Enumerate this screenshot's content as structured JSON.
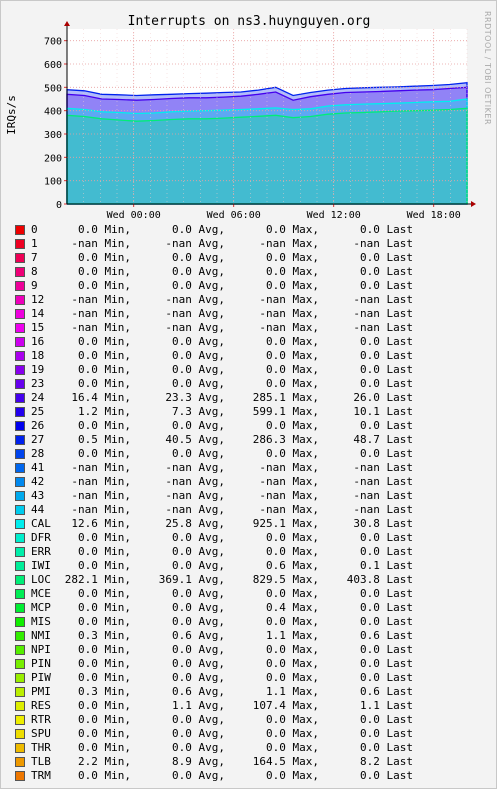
{
  "chart_data": {
    "type": "area",
    "title": "Interrupts on ns3.huynguyen.org",
    "ylabel": "IRQs/s",
    "watermark": "RRDTOOL / TOBI OETIKER",
    "ylim": [
      0,
      750
    ],
    "yticks": [
      0,
      100,
      200,
      300,
      400,
      500,
      600,
      700
    ],
    "xticks": [
      {
        "label": "Wed 00:00",
        "t": 4
      },
      {
        "label": "Wed 06:00",
        "t": 10
      },
      {
        "label": "Wed 12:00",
        "t": 16
      },
      {
        "label": "Wed 18:00",
        "t": 22
      }
    ],
    "xlim": [
      0,
      24
    ],
    "grid": true,
    "series_shown": [
      {
        "name": "LOC",
        "values": [
          380,
          375,
          365,
          360,
          355,
          358,
          362,
          365,
          365,
          368,
          372,
          376,
          380,
          370,
          375,
          385,
          390,
          392,
          395,
          398,
          400,
          402,
          405,
          410
        ]
      },
      {
        "name": "CAL",
        "values": [
          410,
          405,
          395,
          392,
          388,
          390,
          395,
          398,
          400,
          402,
          405,
          408,
          412,
          405,
          408,
          420,
          425,
          428,
          430,
          432,
          435,
          438,
          440,
          450
        ]
      },
      {
        "name": "24",
        "values": [
          470,
          465,
          450,
          448,
          445,
          448,
          452,
          455,
          455,
          458,
          462,
          470,
          480,
          445,
          460,
          470,
          478,
          480,
          482,
          485,
          488,
          490,
          495,
          500
        ]
      },
      {
        "name": "27",
        "values": [
          490,
          485,
          470,
          468,
          465,
          468,
          470,
          473,
          475,
          478,
          480,
          488,
          500,
          465,
          478,
          488,
          495,
          498,
          500,
          502,
          505,
          508,
          512,
          520
        ]
      }
    ],
    "legend": [
      {
        "name": "0",
        "color": "#ee0000",
        "min": "0.0",
        "avg": "0.0",
        "max": "0.0",
        "last": "0.0"
      },
      {
        "name": "1",
        "color": "#ee0022",
        "min": "-nan",
        "avg": "-nan",
        "max": "-nan",
        "last": "-nan"
      },
      {
        "name": "7",
        "color": "#ee0055",
        "min": "0.0",
        "avg": "0.0",
        "max": "0.0",
        "last": "0.0"
      },
      {
        "name": "8",
        "color": "#ee0077",
        "min": "0.0",
        "avg": "0.0",
        "max": "0.0",
        "last": "0.0"
      },
      {
        "name": "9",
        "color": "#ee0099",
        "min": "0.0",
        "avg": "0.0",
        "max": "0.0",
        "last": "0.0"
      },
      {
        "name": "12",
        "color": "#ee00bb",
        "min": "-nan",
        "avg": "-nan",
        "max": "-nan",
        "last": "-nan"
      },
      {
        "name": "14",
        "color": "#ee00dd",
        "min": "-nan",
        "avg": "-nan",
        "max": "-nan",
        "last": "-nan"
      },
      {
        "name": "15",
        "color": "#ee00ee",
        "min": "-nan",
        "avg": "-nan",
        "max": "-nan",
        "last": "-nan"
      },
      {
        "name": "16",
        "color": "#cc00ee",
        "min": "0.0",
        "avg": "0.0",
        "max": "0.0",
        "last": "0.0"
      },
      {
        "name": "18",
        "color": "#aa00ee",
        "min": "0.0",
        "avg": "0.0",
        "max": "0.0",
        "last": "0.0"
      },
      {
        "name": "19",
        "color": "#8800ee",
        "min": "0.0",
        "avg": "0.0",
        "max": "0.0",
        "last": "0.0"
      },
      {
        "name": "23",
        "color": "#6600ee",
        "min": "0.0",
        "avg": "0.0",
        "max": "0.0",
        "last": "0.0"
      },
      {
        "name": "24",
        "color": "#4400ee",
        "min": "16.4",
        "avg": "23.3",
        "max": "285.1",
        "last": "26.0"
      },
      {
        "name": "25",
        "color": "#2200ee",
        "min": "1.2",
        "avg": "7.3",
        "max": "599.1",
        "last": "10.1"
      },
      {
        "name": "26",
        "color": "#0000ee",
        "min": "0.0",
        "avg": "0.0",
        "max": "0.0",
        "last": "0.0"
      },
      {
        "name": "27",
        "color": "#0022ee",
        "min": "0.5",
        "avg": "40.5",
        "max": "286.3",
        "last": "48.7"
      },
      {
        "name": "28",
        "color": "#0044ee",
        "min": "0.0",
        "avg": "0.0",
        "max": "0.0",
        "last": "0.0"
      },
      {
        "name": "41",
        "color": "#0066ee",
        "min": "-nan",
        "avg": "-nan",
        "max": "-nan",
        "last": "-nan"
      },
      {
        "name": "42",
        "color": "#0088ee",
        "min": "-nan",
        "avg": "-nan",
        "max": "-nan",
        "last": "-nan"
      },
      {
        "name": "43",
        "color": "#00aaee",
        "min": "-nan",
        "avg": "-nan",
        "max": "-nan",
        "last": "-nan"
      },
      {
        "name": "44",
        "color": "#00ccee",
        "min": "-nan",
        "avg": "-nan",
        "max": "-nan",
        "last": "-nan"
      },
      {
        "name": "CAL",
        "color": "#00eeee",
        "min": "12.6",
        "avg": "25.8",
        "max": "925.1",
        "last": "30.8"
      },
      {
        "name": "DFR",
        "color": "#00eecc",
        "min": "0.0",
        "avg": "0.0",
        "max": "0.0",
        "last": "0.0"
      },
      {
        "name": "ERR",
        "color": "#00eeaa",
        "min": "0.0",
        "avg": "0.0",
        "max": "0.0",
        "last": "0.0"
      },
      {
        "name": "IWI",
        "color": "#00ee99",
        "min": "0.0",
        "avg": "0.0",
        "max": "0.6",
        "last": "0.1"
      },
      {
        "name": "LOC",
        "color": "#00ee77",
        "min": "282.1",
        "avg": "369.1",
        "max": "829.5",
        "last": "403.8"
      },
      {
        "name": "MCE",
        "color": "#00ee55",
        "min": "0.0",
        "avg": "0.0",
        "max": "0.0",
        "last": "0.0"
      },
      {
        "name": "MCP",
        "color": "#00ee33",
        "min": "0.0",
        "avg": "0.0",
        "max": "0.4",
        "last": "0.0"
      },
      {
        "name": "MIS",
        "color": "#11ee00",
        "min": "0.0",
        "avg": "0.0",
        "max": "0.0",
        "last": "0.0"
      },
      {
        "name": "NMI",
        "color": "#33ee00",
        "min": "0.3",
        "avg": "0.6",
        "max": "1.1",
        "last": "0.6"
      },
      {
        "name": "NPI",
        "color": "#55ee00",
        "min": "0.0",
        "avg": "0.0",
        "max": "0.0",
        "last": "0.0"
      },
      {
        "name": "PIN",
        "color": "#77ee00",
        "min": "0.0",
        "avg": "0.0",
        "max": "0.0",
        "last": "0.0"
      },
      {
        "name": "PIW",
        "color": "#99ee00",
        "min": "0.0",
        "avg": "0.0",
        "max": "0.0",
        "last": "0.0"
      },
      {
        "name": "PMI",
        "color": "#bbee00",
        "min": "0.3",
        "avg": "0.6",
        "max": "1.1",
        "last": "0.6"
      },
      {
        "name": "RES",
        "color": "#ddee00",
        "min": "0.0",
        "avg": "1.1",
        "max": "107.4",
        "last": "1.1"
      },
      {
        "name": "RTR",
        "color": "#eeee00",
        "min": "0.0",
        "avg": "0.0",
        "max": "0.0",
        "last": "0.0"
      },
      {
        "name": "SPU",
        "color": "#eedd00",
        "min": "0.0",
        "avg": "0.0",
        "max": "0.0",
        "last": "0.0"
      },
      {
        "name": "THR",
        "color": "#eebb00",
        "min": "0.0",
        "avg": "0.0",
        "max": "0.0",
        "last": "0.0"
      },
      {
        "name": "TLB",
        "color": "#ee9900",
        "min": "2.2",
        "avg": "8.9",
        "max": "164.5",
        "last": "8.2"
      },
      {
        "name": "TRM",
        "color": "#ee7700",
        "min": "0.0",
        "avg": "0.0",
        "max": "0.0",
        "last": "0.0"
      }
    ]
  },
  "labels": {
    "min": "Min,",
    "avg": "Avg,",
    "max": "Max,",
    "last": "Last"
  }
}
